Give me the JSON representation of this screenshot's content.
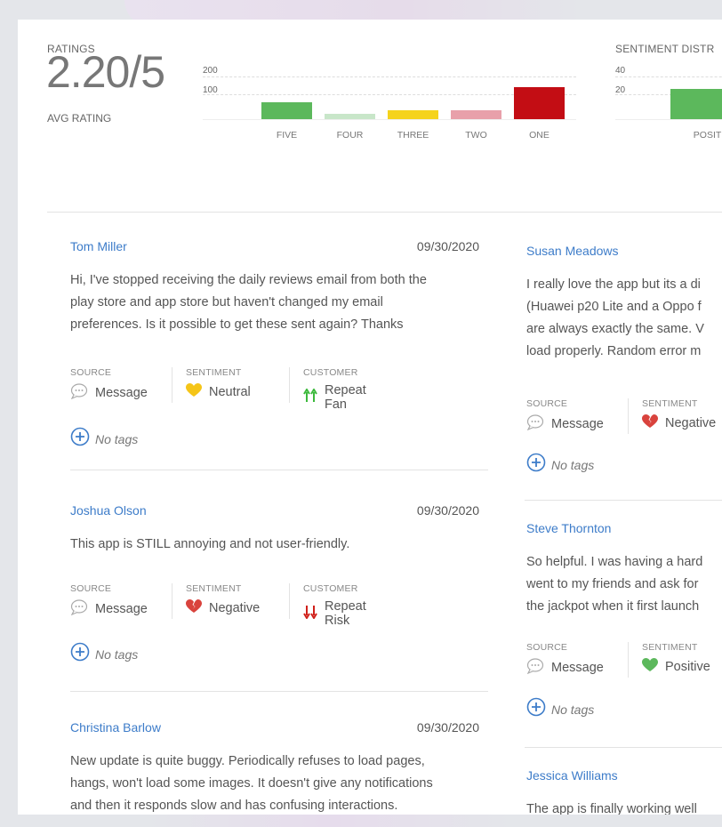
{
  "ratings": {
    "section_label": "RATINGS",
    "avg_value": "2.20",
    "avg_max": "/5",
    "avg_label": "AVG RATING",
    "chart_data": {
      "type": "bar",
      "categories": [
        "FIVE",
        "FOUR",
        "THREE",
        "TWO",
        "ONE"
      ],
      "values": [
        95,
        28,
        48,
        52,
        180
      ],
      "yticks": [
        "200",
        "100"
      ],
      "colors": [
        "#5cb85c",
        "#c8e6c9",
        "#f5d31c",
        "#e8a0aa",
        "#c30d14"
      ]
    }
  },
  "sentiment": {
    "section_label": "SENTIMENT DISTR",
    "chart_data": {
      "type": "bar",
      "categories": [
        "POSITIVE"
      ],
      "values": [
        34
      ],
      "yticks": [
        "40",
        "20"
      ],
      "colors": [
        "#5cb85c"
      ]
    }
  },
  "labels": {
    "source": "SOURCE",
    "sentiment": "SENTIMENT",
    "customer": "CUSTOMER",
    "no_tags": "No tags"
  },
  "reviews_left": [
    {
      "name": "Tom Miller",
      "date": "09/30/2020",
      "lines": [
        "Hi, I've stopped receiving the daily reviews email from both the",
        "play store and app store but haven't changed my email",
        "preferences. Is it possible to get these sent again? Thanks"
      ],
      "source": "Message",
      "sentiment": "Neutral",
      "sentiment_icon": "yellow-heart-icon",
      "customer": "Repeat Fan",
      "customer_icon": "green-up-arrows-icon"
    },
    {
      "name": "Joshua Olson",
      "date": "09/30/2020",
      "lines": [
        "This app is STILL annoying and not user-friendly."
      ],
      "source": "Message",
      "sentiment": "Negative",
      "sentiment_icon": "broken-heart-icon",
      "customer": "Repeat Risk",
      "customer_icon": "red-down-arrows-icon"
    },
    {
      "name": "Christina Barlow",
      "date": "09/30/2020",
      "lines": [
        "New update is quite buggy. Periodically refuses to load pages,",
        "hangs, won't load some images. It doesn't give any notifications",
        "and then it responds slow and has confusing interactions."
      ]
    }
  ],
  "reviews_right": [
    {
      "name": "Susan Meadows",
      "lines": [
        "I really love the app but its a di",
        "(Huawei p20 Lite and a Oppo f",
        "are always exactly the same. V",
        "load properly. Random error m"
      ],
      "source": "Message",
      "sentiment": "Negative",
      "sentiment_icon": "broken-heart-icon"
    },
    {
      "name": "Steve Thornton",
      "lines": [
        "So helpful. I was having a hard",
        "went to my friends and ask for",
        "the jackpot when it first launch"
      ],
      "source": "Message",
      "sentiment": "Positive",
      "sentiment_icon": "green-heart-icon"
    },
    {
      "name": "Jessica Williams",
      "lines": [
        "The app is finally working well"
      ]
    }
  ]
}
